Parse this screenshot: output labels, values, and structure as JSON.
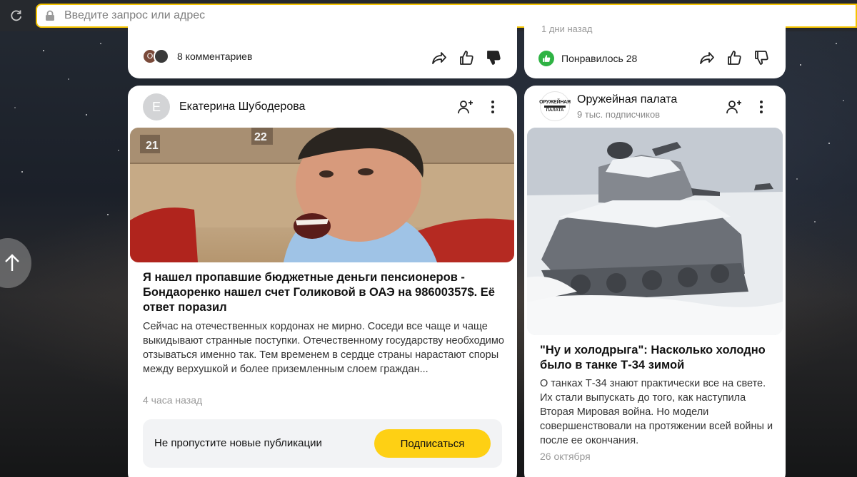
{
  "browser": {
    "address_placeholder": "Введите запрос или адрес"
  },
  "feed": {
    "prev_left": {
      "comments_label": "8 комментариев",
      "avatar_letter": "О"
    },
    "prev_right": {
      "truncated_label": "1 дни назад",
      "liked_label": "Понравилось 28"
    },
    "card_left": {
      "author_initial": "Е",
      "author_name": "Екатерина Шубодерова",
      "image_caption_numbers": [
        "21",
        "22"
      ],
      "title": "Я нашел пропавшие бюджетные деньги пенсионеров - Бондаоренко нашел счет Голиковой в ОАЭ на 98600357$. Её ответ поразил",
      "body": "Сейчас на отечественных кордонах не мирно. Соседи все чаще и чаще выкидывают странные поступки. Отечественному государству необходимо отзываться именно так. Тем временем в сердце страны нарастают споры между верхушкой и более приземленным слоем граждан...",
      "date": "4 часа назад",
      "subscribe_prompt": "Не пропустите новые публикации",
      "subscribe_button": "Подписаться"
    },
    "card_right": {
      "logo_line1": "ОРУЖЕЙНАЯ",
      "logo_line2": "ПАЛАТА",
      "channel_name": "Оружейная палата",
      "channel_subs": "9 тыс. подписчиков",
      "title": "\"Ну и холодрыга\": Насколько холодно было в танке Т-34 зимой",
      "body": "О танках Т-34 знают практически все на свете. Их стали выпускать до того, как наступила Вторая Мировая война. Но модели совершенствовали на протяжении всей войны и после ее окончания.",
      "date": "26 октября"
    }
  },
  "colors": {
    "accent_yellow": "#fed014",
    "like_green": "#2fb344",
    "address_border": "#f5c400"
  }
}
